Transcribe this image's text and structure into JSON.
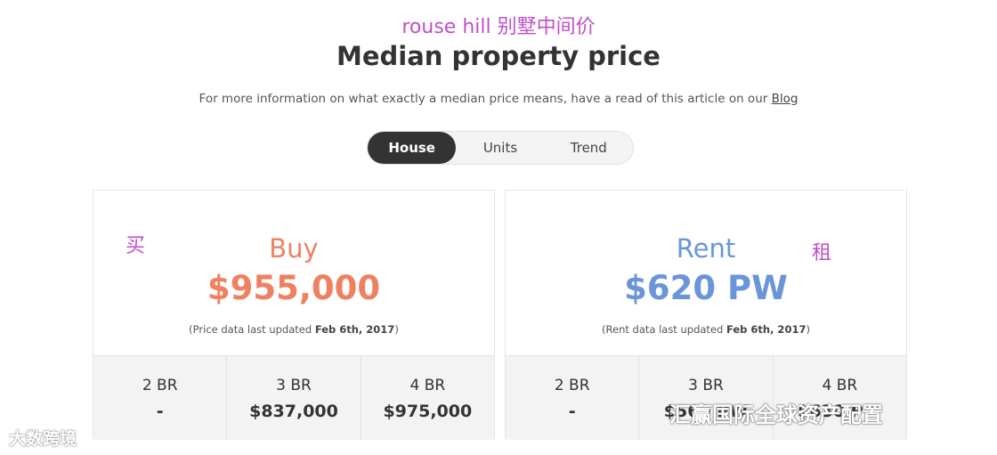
{
  "annotation": {
    "title": "rouse hill 别墅中间价",
    "buy": "买",
    "rent": "租"
  },
  "header": {
    "title": "Median property price",
    "intro_text": "For more information on what exactly a median price means, have a read of this article on our ",
    "intro_link": "Blog"
  },
  "tabs": [
    {
      "label": "House",
      "active": true
    },
    {
      "label": "Units",
      "active": false
    },
    {
      "label": "Trend",
      "active": false
    }
  ],
  "buy": {
    "heading": "Buy",
    "price": "$955,000",
    "note_prefix": "(Price data last updated ",
    "note_date": "Feb 6th, 2017",
    "note_suffix": ")",
    "beds": [
      {
        "label": "2 BR",
        "value": "-"
      },
      {
        "label": "3 BR",
        "value": "$837,000"
      },
      {
        "label": "4 BR",
        "value": "$975,000"
      }
    ]
  },
  "rent": {
    "heading": "Rent",
    "price": "$620 PW",
    "note_prefix": "(Rent data last updated ",
    "note_date": "Feb 6th, 2017",
    "note_suffix": ")",
    "beds": [
      {
        "label": "2 BR",
        "value": "-"
      },
      {
        "label": "3 BR",
        "value": "$560 PW"
      },
      {
        "label": "4 BR",
        "value": "$630 PW"
      }
    ]
  },
  "watermarks": {
    "left": "大数跨境",
    "right": "汇赢国际全球资产配置"
  },
  "colors": {
    "buy": "#ef8161",
    "rent": "#6a95d8",
    "annotation": "#c04fc9",
    "tab_active": "#333333"
  }
}
